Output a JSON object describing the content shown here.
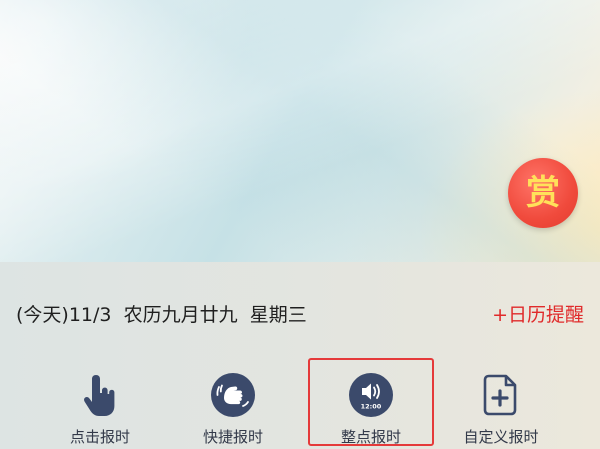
{
  "reward": {
    "label": "赏"
  },
  "date_line": {
    "today": "(今天)11/3",
    "lunar": "农历九月廿九",
    "weekday": "星期三"
  },
  "calendar_reminder": {
    "label": "+日历提醒"
  },
  "actions": [
    {
      "label": "点击报时",
      "icon": "tap-hand-icon"
    },
    {
      "label": "快捷报时",
      "icon": "quick-announce-icon"
    },
    {
      "label": "整点报时",
      "icon": "speaker-clock-icon",
      "clock_text": "12:00",
      "selected": true
    },
    {
      "label": "自定义报时",
      "icon": "document-add-icon"
    }
  ],
  "colors": {
    "icon": "#3b4a6b",
    "reminder": "#e02a2a",
    "highlight": "#e53a3a",
    "reward_bg": "#f04a3c",
    "reward_text": "#ffe15a"
  }
}
